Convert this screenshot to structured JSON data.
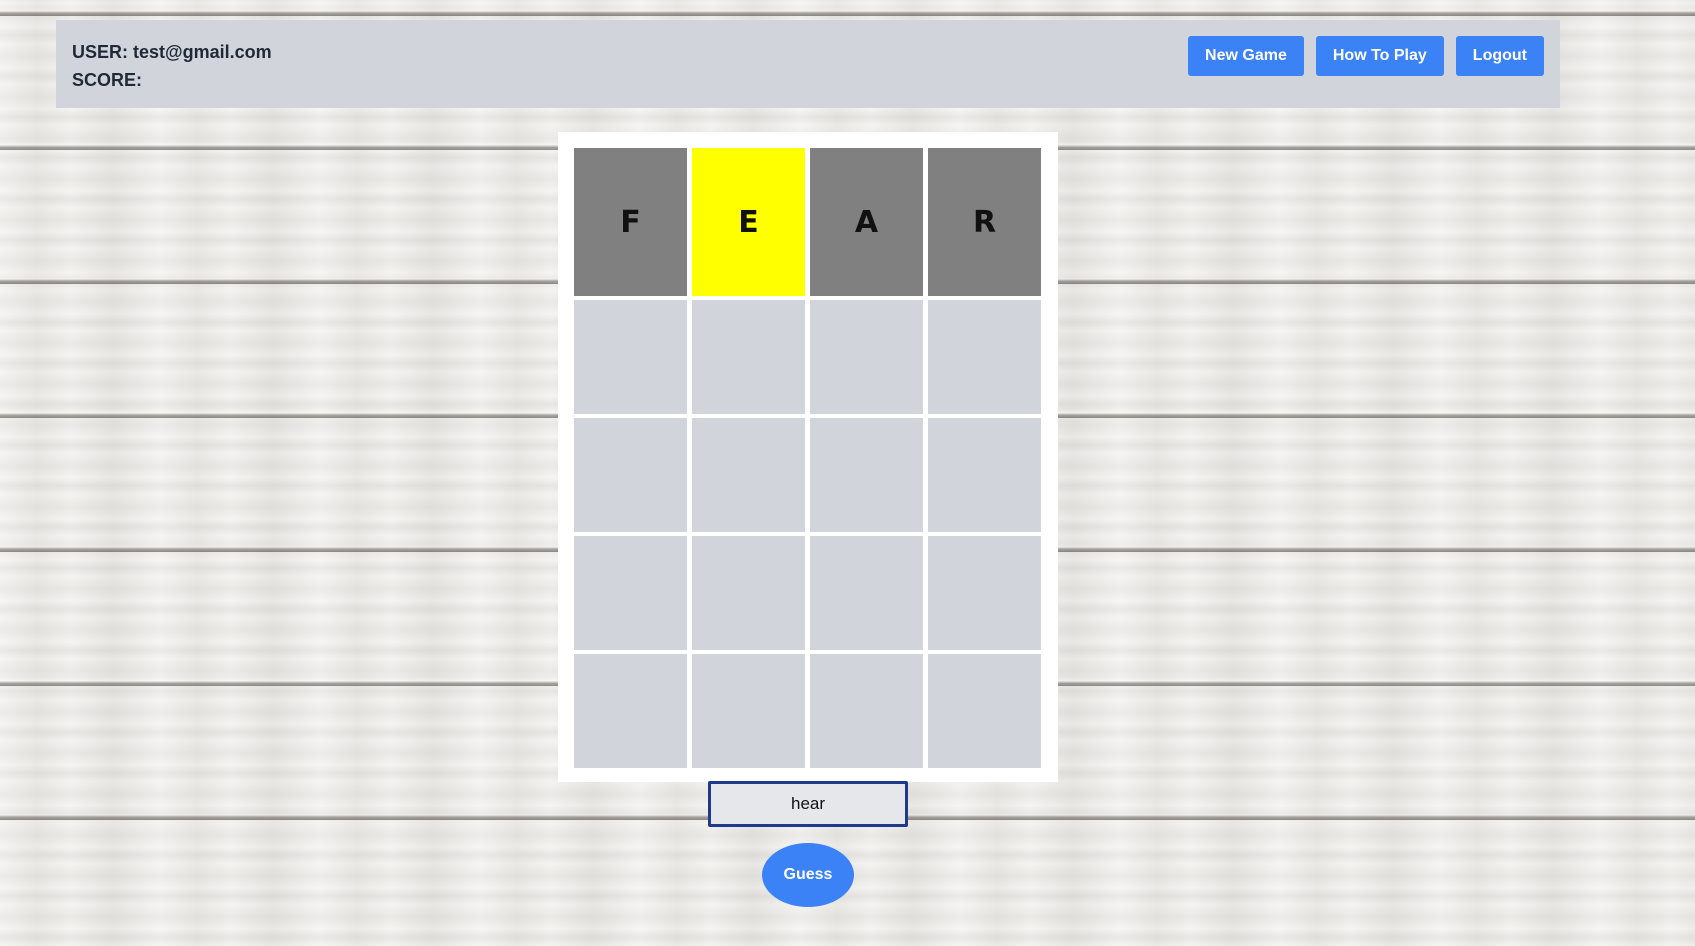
{
  "header": {
    "user_label": "USER:",
    "user_email": "test@gmail.com",
    "score_label": "SCORE:",
    "score_value": ""
  },
  "nav": {
    "new_game_label": "New Game",
    "how_to_play_label": "How To Play",
    "logout_label": "Logout"
  },
  "board": {
    "rows": [
      [
        {
          "letter": "F",
          "state": "absent"
        },
        {
          "letter": "E",
          "state": "present"
        },
        {
          "letter": "A",
          "state": "absent"
        },
        {
          "letter": "R",
          "state": "absent"
        }
      ],
      [
        {
          "letter": "",
          "state": "empty"
        },
        {
          "letter": "",
          "state": "empty"
        },
        {
          "letter": "",
          "state": "empty"
        },
        {
          "letter": "",
          "state": "empty"
        }
      ],
      [
        {
          "letter": "",
          "state": "empty"
        },
        {
          "letter": "",
          "state": "empty"
        },
        {
          "letter": "",
          "state": "empty"
        },
        {
          "letter": "",
          "state": "empty"
        }
      ],
      [
        {
          "letter": "",
          "state": "empty"
        },
        {
          "letter": "",
          "state": "empty"
        },
        {
          "letter": "",
          "state": "empty"
        },
        {
          "letter": "",
          "state": "empty"
        }
      ],
      [
        {
          "letter": "",
          "state": "empty"
        },
        {
          "letter": "",
          "state": "empty"
        },
        {
          "letter": "",
          "state": "empty"
        },
        {
          "letter": "",
          "state": "empty"
        }
      ]
    ]
  },
  "guess": {
    "input_value": "hear",
    "button_label": "Guess"
  },
  "colors": {
    "absent": "#808080",
    "present": "#ffff00",
    "empty": "#d1d5db",
    "accent": "#3b82f6",
    "header_bg": "#d1d5db"
  }
}
